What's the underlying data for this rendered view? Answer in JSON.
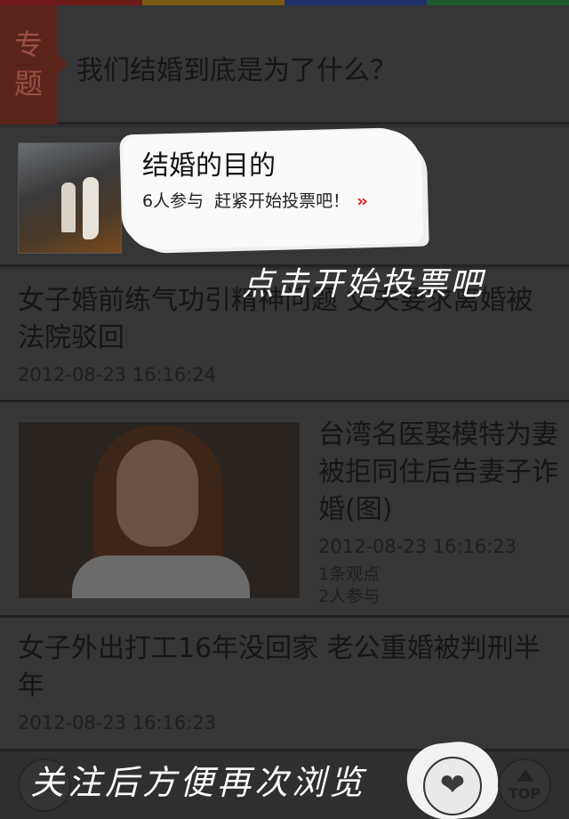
{
  "colors": {
    "topbar": [
      "#6e1a1a",
      "#7a5a0e",
      "#1f2f6e",
      "#1e5a2e"
    ],
    "background": "#363636",
    "accent": "#e11b22"
  },
  "header": {
    "tag": "专题",
    "title": "我们结婚到底是为了什么？"
  },
  "vote": {
    "title": "结婚的目的",
    "participants": "6人参与",
    "cta": "赶紧开始投票吧！",
    "arrow_icon": "double-chevron-right-icon"
  },
  "overlay_hint": "点击开始投票吧",
  "news": [
    {
      "title": "女子婚前练气功引精神问题 丈夫要求离婚被法院驳回",
      "time": "2012-08-23 16:16:24"
    },
    {
      "title": "台湾名医娶模特为妻 被拒同住后告妻子诈婚(图)",
      "time": "2012-08-23 16:16:23",
      "opinions": "1条观点",
      "participants": "2人参与"
    },
    {
      "title": "女子外出打工16年没回家 老公重婚被判刑半年",
      "time": "2012-08-23 16:16:23"
    }
  ],
  "bottom": {
    "hint": "关注后方便再次浏览",
    "favorite_icon": "heart-icon",
    "top_label": "TOP"
  }
}
